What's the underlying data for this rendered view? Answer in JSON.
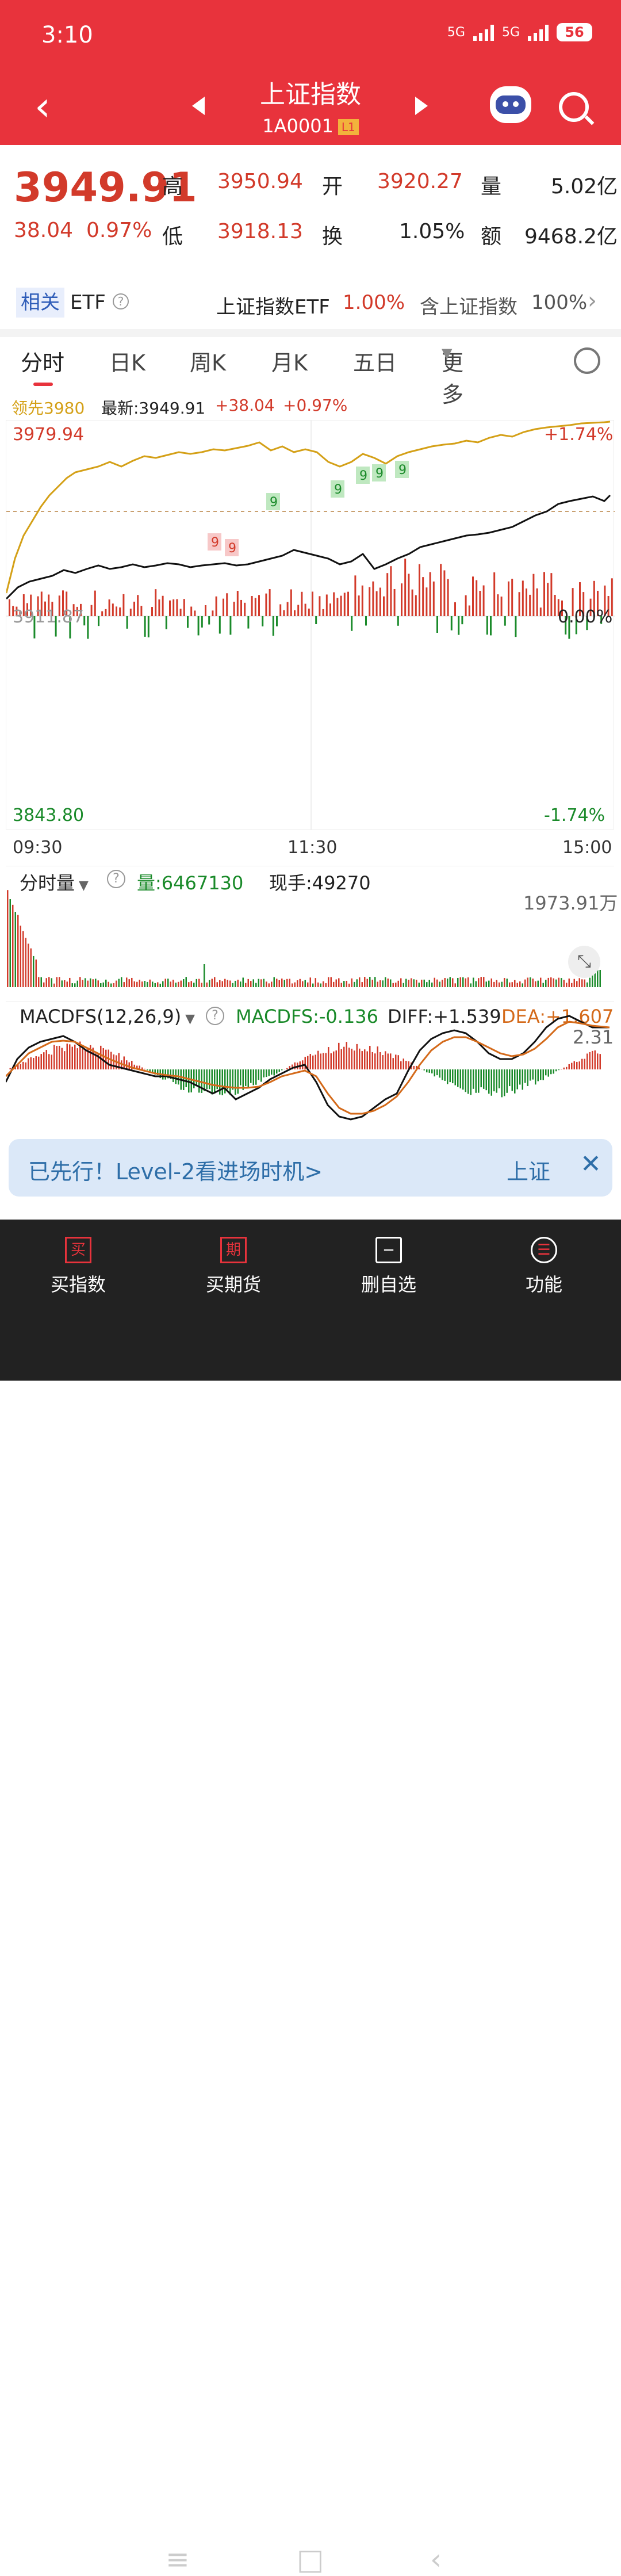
{
  "status": {
    "time": "3:10",
    "battery": "56",
    "net1": "5G",
    "net2": "5G"
  },
  "header": {
    "title": "上证指数",
    "code": "1A0001",
    "level": "L1"
  },
  "quote": {
    "price": "3949.91",
    "change": "38.04",
    "pct": "0.97%",
    "labels": {
      "high": "高",
      "low": "低",
      "open": "开",
      "turnover": "换",
      "volume": "量",
      "amount": "额"
    },
    "high": "3950.94",
    "low": "3918.13",
    "open": "3920.27",
    "turnover_rate": "1.05%",
    "volume": "5.02亿",
    "amount": "9468.2亿"
  },
  "etf": {
    "tag": "相关",
    "label": "ETF",
    "name": "上证指数ETF",
    "pct": "1.00%",
    "contains": "含上证指数",
    "weight": "100%"
  },
  "tabs": [
    "分时",
    "日K",
    "周K",
    "月K",
    "五日",
    "更多"
  ],
  "legend": {
    "lead": "领先3980",
    "latest": "最新:3949.91",
    "change": "+38.04",
    "pct": "+0.97%"
  },
  "axis": {
    "top": "3979.94",
    "top_pct": "+1.74%",
    "mid": "3911.87",
    "mid_pct": "0.00%",
    "bottom": "3843.80",
    "bottom_pct": "-1.74%",
    "t0": "09:30",
    "t1": "11:30",
    "t2": "15:00"
  },
  "signals": [
    "9",
    "9",
    "9",
    "9",
    "9",
    "9",
    "9",
    "9"
  ],
  "volume": {
    "label": "分时量",
    "qty": "量:6467130",
    "now": "现手:49270",
    "max": "1973.91万"
  },
  "macd": {
    "label": "MACDFS(12,26,9)",
    "macdfs": "MACDFS:-0.136",
    "diff": "DIFF:+1.539",
    "dea": "DEA:+1.607",
    "max": "2.31"
  },
  "banner": {
    "text": "已先行！Level-2看进场时机>",
    "right": "上证"
  },
  "nav": [
    {
      "icon": "买",
      "label": "买指数"
    },
    {
      "icon": "期",
      "label": "买期货"
    },
    {
      "icon": "−",
      "label": "删自选"
    },
    {
      "icon": "☰",
      "label": "功能"
    }
  ],
  "colors": {
    "brand": "#e8333c",
    "up": "#d23a2a",
    "down": "#1a8a2a",
    "lead": "#d4a017"
  }
}
